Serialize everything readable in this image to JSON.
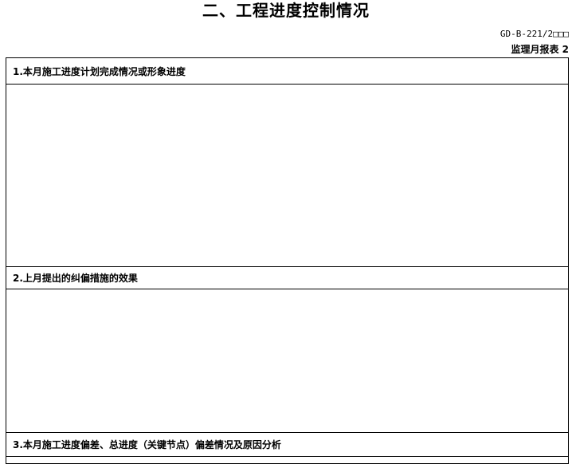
{
  "title": "二、工程进度控制情况",
  "form_code": "GD-B-221/2□□□",
  "report_label": "监理月报表 2",
  "sections": [
    {
      "label": "1.本月施工进度计划完成情况或形象进度",
      "content": ""
    },
    {
      "label": "2.上月提出的纠偏措施的效果",
      "content": ""
    },
    {
      "label": "3.本月施工进度偏差、总进度（关键节点）偏差情况及原因分析",
      "content": ""
    }
  ]
}
